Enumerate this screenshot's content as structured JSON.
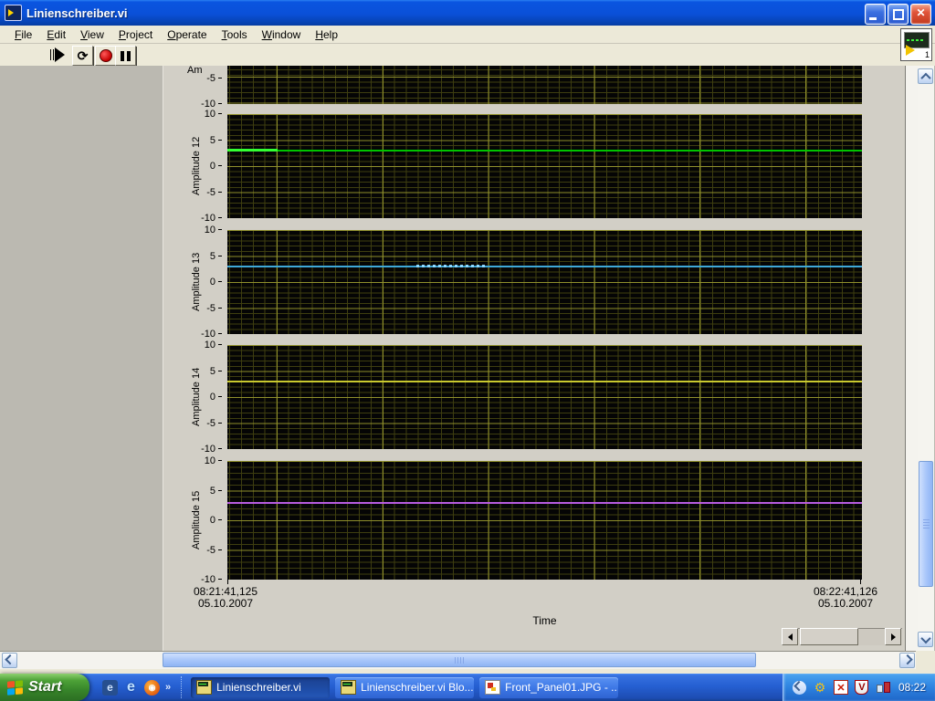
{
  "window": {
    "title": "Linienschreiber.vi"
  },
  "menu": {
    "items": [
      {
        "accel": "F",
        "rest": "ile"
      },
      {
        "accel": "E",
        "rest": "dit"
      },
      {
        "accel": "V",
        "rest": "iew"
      },
      {
        "accel": "P",
        "rest": "roject"
      },
      {
        "accel": "O",
        "rest": "perate"
      },
      {
        "accel": "T",
        "rest": "ools"
      },
      {
        "accel": "W",
        "rest": "indow"
      },
      {
        "accel": "H",
        "rest": "elp"
      }
    ]
  },
  "toolbar": {
    "icons": [
      "run-icon",
      "run-continuously-icon",
      "abort-icon",
      "pause-icon"
    ]
  },
  "vi_icon_number": "1",
  "chart_data": {
    "type": "line",
    "xlabel": "Time",
    "ylim": [
      -10,
      10
    ],
    "yticks": [
      10,
      5,
      0,
      -5,
      -10
    ],
    "grid": true,
    "x_axis": {
      "start_time": "08:21:41,125",
      "start_date": "05.10.2007",
      "end_time": "08:22:41,126",
      "end_date": "05.10.2007"
    },
    "panels": [
      {
        "ylabel": "Am",
        "partial": true,
        "visible_yticks": [
          -5,
          -10
        ],
        "trace": null
      },
      {
        "ylabel": "Amplitude 12",
        "trace": {
          "value": 3,
          "shape": "constant",
          "color": "#00c400",
          "segment": {
            "from": 0.0,
            "to": 0.079,
            "color": "#33ff33",
            "dotted": false
          }
        }
      },
      {
        "ylabel": "Amplitude 13",
        "trace": {
          "value": 3,
          "shape": "constant",
          "color": "#3fa8d8",
          "segment": {
            "from": 0.298,
            "to": 0.41,
            "color": "#8ed9ff",
            "dotted": true
          }
        }
      },
      {
        "ylabel": "Amplitude 14",
        "trace": {
          "value": 3,
          "shape": "constant",
          "color": "#c9c92e"
        }
      },
      {
        "ylabel": "Amplitude 15",
        "trace": {
          "value": 3,
          "shape": "constant",
          "color": "#b85ce0"
        }
      }
    ]
  },
  "taskbar": {
    "start_label": "Start",
    "quick_launch_overflow": "»",
    "buttons": [
      {
        "label": "Linienschreiber.vi",
        "icon": "labview",
        "active": true
      },
      {
        "label": "Linienschreiber.vi Blo...",
        "icon": "labview",
        "active": false
      },
      {
        "label": "Front_Panel01.JPG - ...",
        "icon": "image-viewer",
        "active": false
      }
    ],
    "clock": "08:22"
  }
}
